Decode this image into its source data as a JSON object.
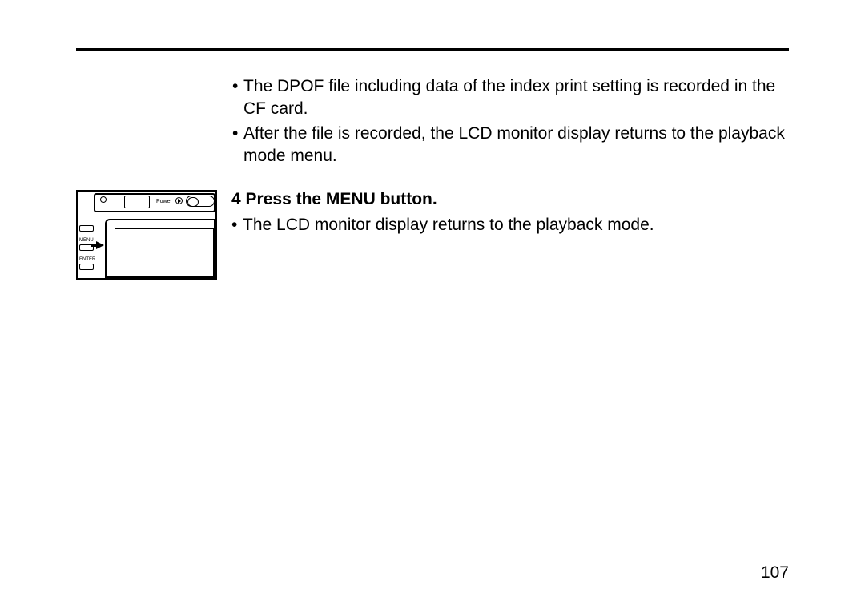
{
  "bullets": {
    "b1": "The DPOF file including data of the index print setting is recorded in the CF card.",
    "b2": "After the file is recorded, the LCD monitor display returns to the playback mode menu."
  },
  "step": {
    "num": "4",
    "title_rest": "Press the MENU button.",
    "sub": "The LCD monitor display returns to the playback mode."
  },
  "diagram": {
    "power": "Power",
    "display": "",
    "menu": "MENU",
    "enter": "ENTER"
  },
  "page_number": "107"
}
